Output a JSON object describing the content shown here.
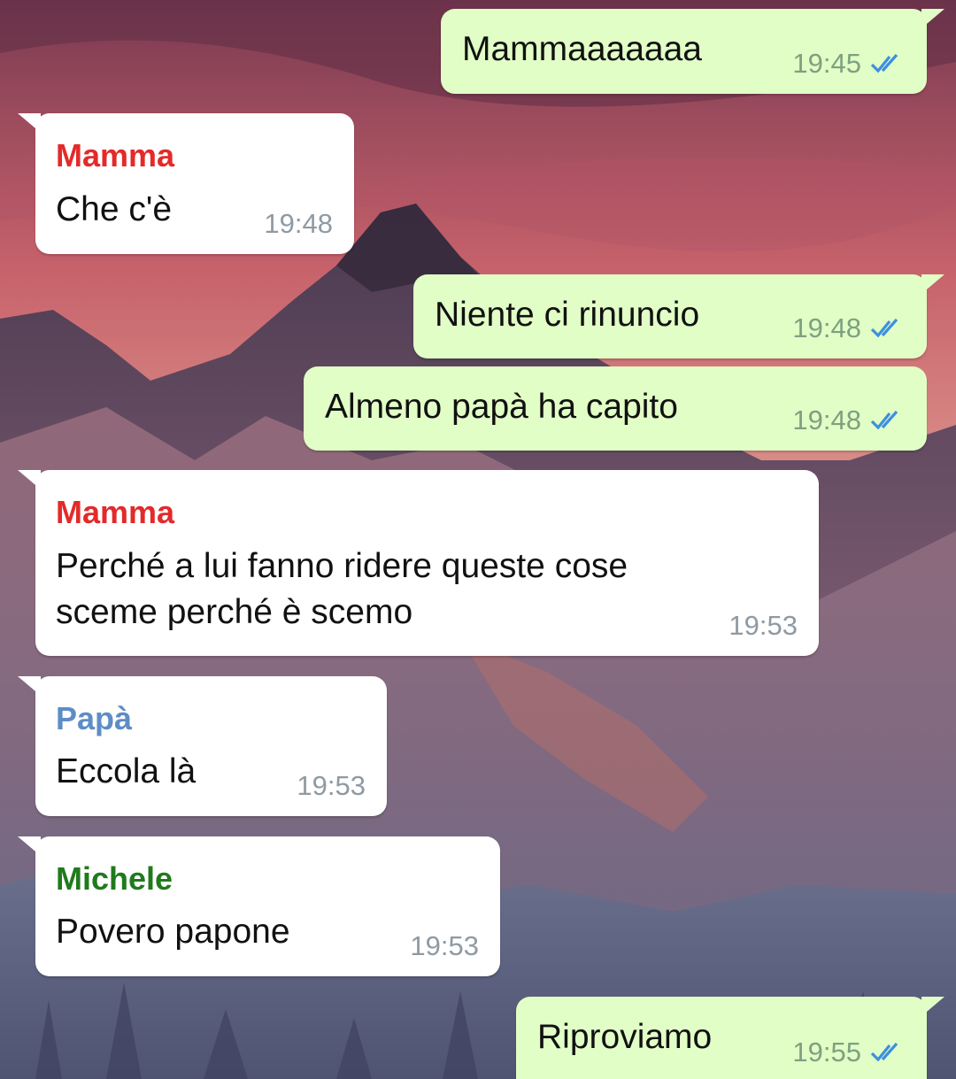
{
  "colors": {
    "outgoing_bubble": "#e1fec6",
    "incoming_bubble": "#ffffff",
    "read_ticks": "#3d8fe0",
    "sender_mamma": "#e32a2a",
    "sender_papa": "#5e8dc6",
    "sender_michele": "#207a1c"
  },
  "messages": [
    {
      "direction": "out",
      "text": "Mammaaaaaaa",
      "time": "19:45",
      "status_icon": "double-check-read-icon"
    },
    {
      "direction": "in",
      "sender": "Mamma",
      "text": "Che c'è",
      "time": "19:48"
    },
    {
      "direction": "out",
      "text": "Niente ci rinuncio",
      "time": "19:48",
      "status_icon": "double-check-read-icon"
    },
    {
      "direction": "out",
      "text": "Almeno papà ha capito",
      "time": "19:48",
      "status_icon": "double-check-read-icon"
    },
    {
      "direction": "in",
      "sender": "Mamma",
      "text": "Perché a lui fanno ridere queste cose\nsceme perché è scemo",
      "time": "19:53"
    },
    {
      "direction": "in",
      "sender": "Papà",
      "text": "Eccola là",
      "time": "19:53"
    },
    {
      "direction": "in",
      "sender": "Michele",
      "text": "Povero papone",
      "time": "19:53"
    },
    {
      "direction": "out",
      "text": "Riproviamo",
      "time": "19:55",
      "status_icon": "double-check-read-icon"
    }
  ]
}
